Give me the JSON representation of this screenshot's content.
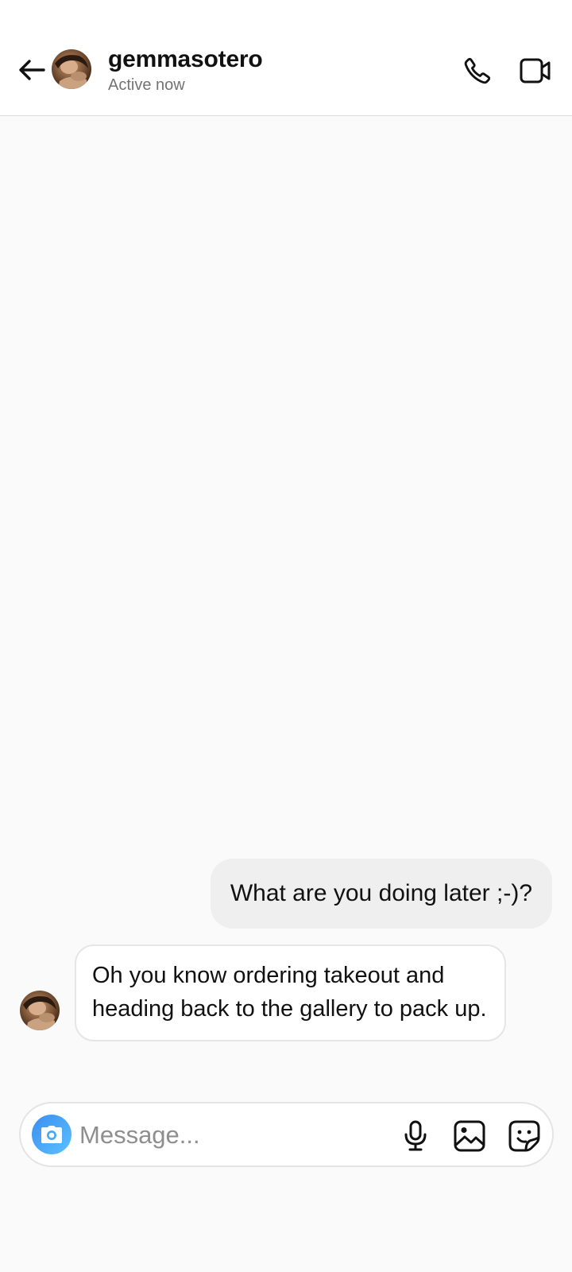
{
  "header": {
    "username": "gemmasotero",
    "status": "Active now",
    "back_icon": "arrow-left-icon",
    "call_icon": "phone-icon",
    "video_icon": "video-camera-icon"
  },
  "messages": [
    {
      "direction": "sent",
      "text": "What are you doing later ;-)?"
    },
    {
      "direction": "received",
      "text": "Oh you know ordering takeout and heading back to the gallery to pack up."
    }
  ],
  "composer": {
    "placeholder": "Message...",
    "value": "",
    "icons": [
      "camera-icon",
      "microphone-icon",
      "image-icon",
      "sticker-icon"
    ]
  },
  "colors": {
    "sent_bubble": "#efefef",
    "received_bubble_border": "#e6e6e6",
    "camera_gradient_start": "#3a8ef0",
    "camera_gradient_end": "#5cc0ff",
    "status_text": "#737373"
  }
}
